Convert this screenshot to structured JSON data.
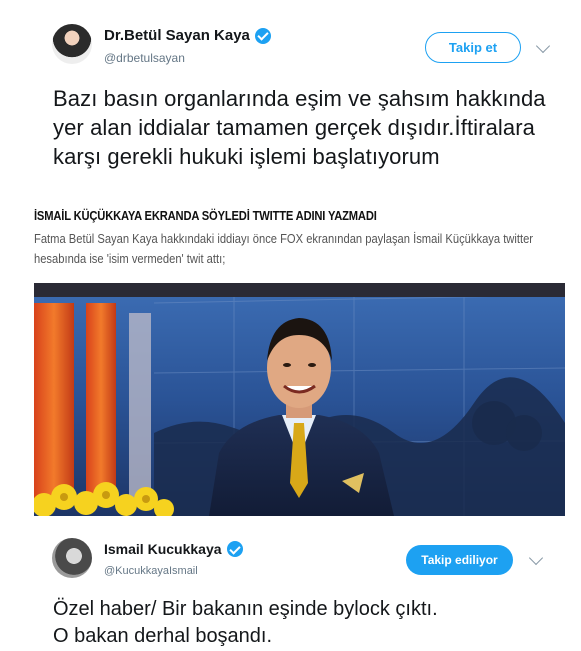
{
  "tweet1": {
    "author_name": "Dr.Betül Sayan Kaya",
    "handle": "@drbetulsayan",
    "follow_label": "Takip et",
    "text": "Bazı basın organlarında eşim ve şahsım hakkında yer alan iddialar tamamen gerçek dışıdır.İftiralara karşı gerekli hukuki işlemi başlatıyorum"
  },
  "article": {
    "headline": "İSMAİL KÜÇÜKKAYA EKRANDA SÖYLEDİ TWITTE ADINI YAZMADI",
    "body": "Fatma Betül Sayan Kaya hakkındaki iddiayı önce FOX ekranından paylaşan İsmail Küçükkaya twitter hesabında ise 'isim vermeden' twit attı;"
  },
  "tweet2": {
    "author_name": "Ismail Kucukkaya",
    "handle": "@KucukkayaIsmail",
    "following_label": "Takip ediliyor",
    "text_line1": "Özel haber/ Bir bakanın eşinde bylock çıktı.",
    "text_line2": "O bakan derhal boşandı."
  },
  "colors": {
    "twitter_blue": "#1da1f2",
    "text_primary": "#14171a",
    "text_secondary": "#657786"
  },
  "icons": [
    "verified-badge-icon",
    "chevron-down-icon"
  ]
}
